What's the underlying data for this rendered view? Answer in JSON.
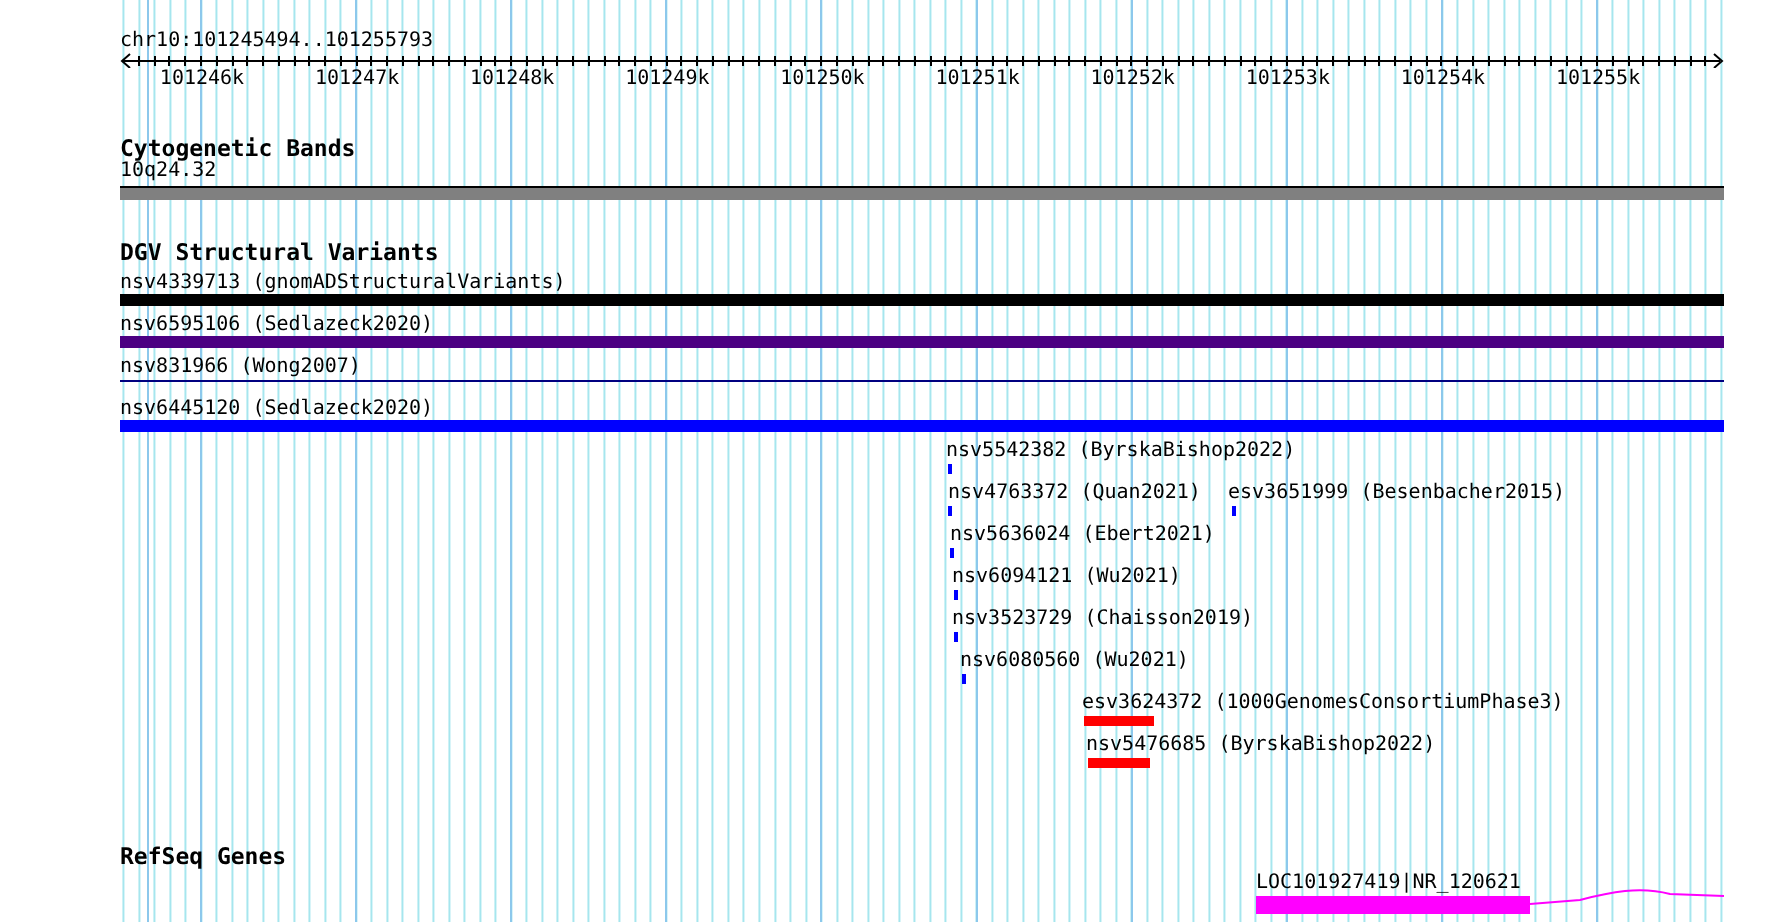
{
  "ruler": {
    "location": "chr10:101245494..101255793",
    "ticks": [
      "101246k",
      "101247k",
      "101248k",
      "101249k",
      "101250k",
      "101251k",
      "101252k",
      "101253k",
      "101254k",
      "101255k"
    ]
  },
  "tracks": [
    {
      "kind": "bands",
      "title": "Cytogenetic Bands",
      "features": [
        {
          "label": "10q24.32",
          "color": "#808080"
        }
      ]
    },
    {
      "kind": "variants",
      "title": "DGV Structural Variants",
      "features": [
        {
          "label": "nsv4339713 (gnomADStructuralVariants)",
          "color": "#000000",
          "kind": "full"
        },
        {
          "label": "nsv6595106 (Sedlazeck2020)",
          "color": "#4b0082",
          "kind": "full"
        },
        {
          "label": "nsv831966 (Wong2007)",
          "color": "#000080",
          "kind": "line"
        },
        {
          "label": "nsv6445120 (Sedlazeck2020)",
          "color": "#0000ff",
          "kind": "full"
        },
        {
          "label": "nsv5542382 (ByrskaBishop2022)",
          "color": "#0000ff",
          "kind": "small"
        },
        {
          "label": "nsv4763372 (Quan2021)",
          "color": "#0000ff",
          "kind": "small"
        },
        {
          "label": "esv3651999 (Besenbacher2015)",
          "color": "#0000ff",
          "kind": "small"
        },
        {
          "label": "nsv5636024 (Ebert2021)",
          "color": "#0000ff",
          "kind": "small"
        },
        {
          "label": "nsv6094121 (Wu2021)",
          "color": "#0000ff",
          "kind": "small"
        },
        {
          "label": "nsv3523729 (Chaisson2019)",
          "color": "#0000ff",
          "kind": "small"
        },
        {
          "label": "nsv6080560 (Wu2021)",
          "color": "#0000ff",
          "kind": "small"
        },
        {
          "label": "esv3624372 (1000GenomesConsortiumPhase3)",
          "color": "#ff0000",
          "kind": "small"
        },
        {
          "label": "nsv5476685 (ByrskaBishop2022)",
          "color": "#ff0000",
          "kind": "small"
        }
      ]
    },
    {
      "kind": "genes",
      "title": "RefSeq Genes",
      "features": [
        {
          "label": "LOC101927419|NR_120621",
          "color": "#ff00ff"
        }
      ]
    }
  ]
}
